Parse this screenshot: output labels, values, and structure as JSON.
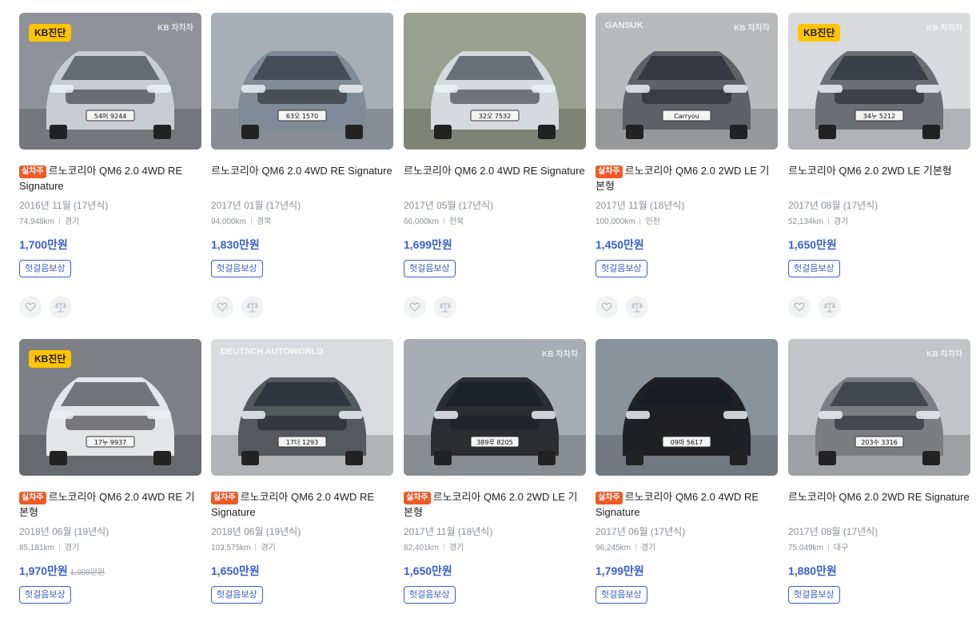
{
  "listings": [
    {
      "title": "르노코리아 QM6 2.0 4WD RE Signature",
      "badge_sil": "실차주",
      "kb_badge": "KB진단",
      "watermark": "KB 차차차",
      "plate": "54머 9244",
      "year": "2016년 11월 (17년식)",
      "mileage": "74,948km",
      "region": "경기",
      "price": "1,700만원",
      "old_price": "",
      "tag": "헛걸음보상",
      "car_color": "#c9ccd1",
      "bg": "#8f9298"
    },
    {
      "title": "르노코리아 QM6 2.0 4WD RE Signature",
      "badge_sil": "",
      "kb_badge": "",
      "watermark": "",
      "plate": "63오 1570",
      "year": "2017년 01월 (17년식)",
      "mileage": "94,000km",
      "region": "경북",
      "price": "1,830만원",
      "old_price": "",
      "tag": "헛걸음보상",
      "car_color": "#7f8b98",
      "bg": "#a8aeb5"
    },
    {
      "title": "르노코리아 QM6 2.0 4WD RE Signature",
      "badge_sil": "",
      "kb_badge": "",
      "watermark": "",
      "plate": "32오 7532",
      "year": "2017년 05월 (17년식)",
      "mileage": "66,000km",
      "region": "전북",
      "price": "1,699만원",
      "old_price": "",
      "tag": "헛걸음보상",
      "car_color": "#d6d9dd",
      "bg": "#9aa08f"
    },
    {
      "title": "르노코리아 QM6 2.0 2WD LE 기본형",
      "badge_sil": "실차주",
      "kb_badge": "",
      "watermark": "KB 차차차",
      "plate": "Carryou",
      "year": "2017년 11월 (18년식)",
      "mileage": "100,000km",
      "region": "인천",
      "price": "1,450만원",
      "old_price": "",
      "tag": "헛걸음보상",
      "car_color": "#5f6166",
      "bg": "#b9babc",
      "brand": "GANSUK"
    },
    {
      "title": "르노코리아 QM6 2.0 2WD LE 기본형",
      "badge_sil": "",
      "kb_badge": "KB진단",
      "watermark": "KB 차차차",
      "plate": "34누 5212",
      "year": "2017년 08월 (17년식)",
      "mileage": "52,134km",
      "region": "경기",
      "price": "1,650만원",
      "old_price": "",
      "tag": "헛걸음보상",
      "car_color": "#6b6e73",
      "bg": "#d8dadd"
    },
    {
      "title": "르노코리아 QM6 2.0 4WD RE 기본형",
      "badge_sil": "실차주",
      "kb_badge": "KB진단",
      "watermark": "",
      "plate": "17누 9937",
      "year": "2018년 06월 (19년식)",
      "mileage": "85,181km",
      "region": "경기",
      "price": "1,970만원",
      "old_price": "1,999만원",
      "tag": "헛걸음보상",
      "car_color": "#e4e5e7",
      "bg": "#7d8085"
    },
    {
      "title": "르노코리아 QM6 2.0 4WD RE Signature",
      "badge_sil": "실차주",
      "kb_badge": "",
      "watermark": "",
      "plate": "17더 1293",
      "year": "2018년 06월 (19년식)",
      "mileage": "103,575km",
      "region": "경기",
      "price": "1,650만원",
      "old_price": "",
      "tag": "헛걸음보상",
      "car_color": "#55585d",
      "bg": "#d9dbde",
      "brand": "DEUTSCH AUTOWORLD"
    },
    {
      "title": "르노코리아 QM6 2.0 2WD LE 기본형",
      "badge_sil": "실차주",
      "kb_badge": "",
      "watermark": "KB 차차차",
      "plate": "389루 8205",
      "year": "2017년 11월 (18년식)",
      "mileage": "82,401km",
      "region": "경기",
      "price": "1,650만원",
      "old_price": "",
      "tag": "헛걸음보상",
      "car_color": "#2b2d31",
      "bg": "#a7adb3"
    },
    {
      "title": "르노코리아 QM6 2.0 4WD RE Signature",
      "badge_sil": "실차주",
      "kb_badge": "",
      "watermark": "",
      "plate": "09마 5617",
      "year": "2017년 06월 (17년식)",
      "mileage": "96,245km",
      "region": "경기",
      "price": "1,799만원",
      "old_price": "",
      "tag": "헛걸음보상",
      "car_color": "#1f2024",
      "bg": "#8a939b"
    },
    {
      "title": "르노코리아 QM6 2.0 2WD RE Signature",
      "badge_sil": "",
      "kb_badge": "",
      "watermark": "KB 차차차",
      "plate": "203수 3316",
      "year": "2017년 08월 (17년식)",
      "mileage": "75,049km",
      "region": "대구",
      "price": "1,880만원",
      "old_price": "",
      "tag": "헛걸음보상",
      "car_color": "#7b7d80",
      "bg": "#c2c4c7"
    }
  ],
  "icons": {
    "like": "heart-icon",
    "compare": "scale-icon"
  },
  "colors": {
    "price": "#3a5fcd",
    "sil_badge": "#f05a28",
    "kb_badge": "#ffc400"
  }
}
